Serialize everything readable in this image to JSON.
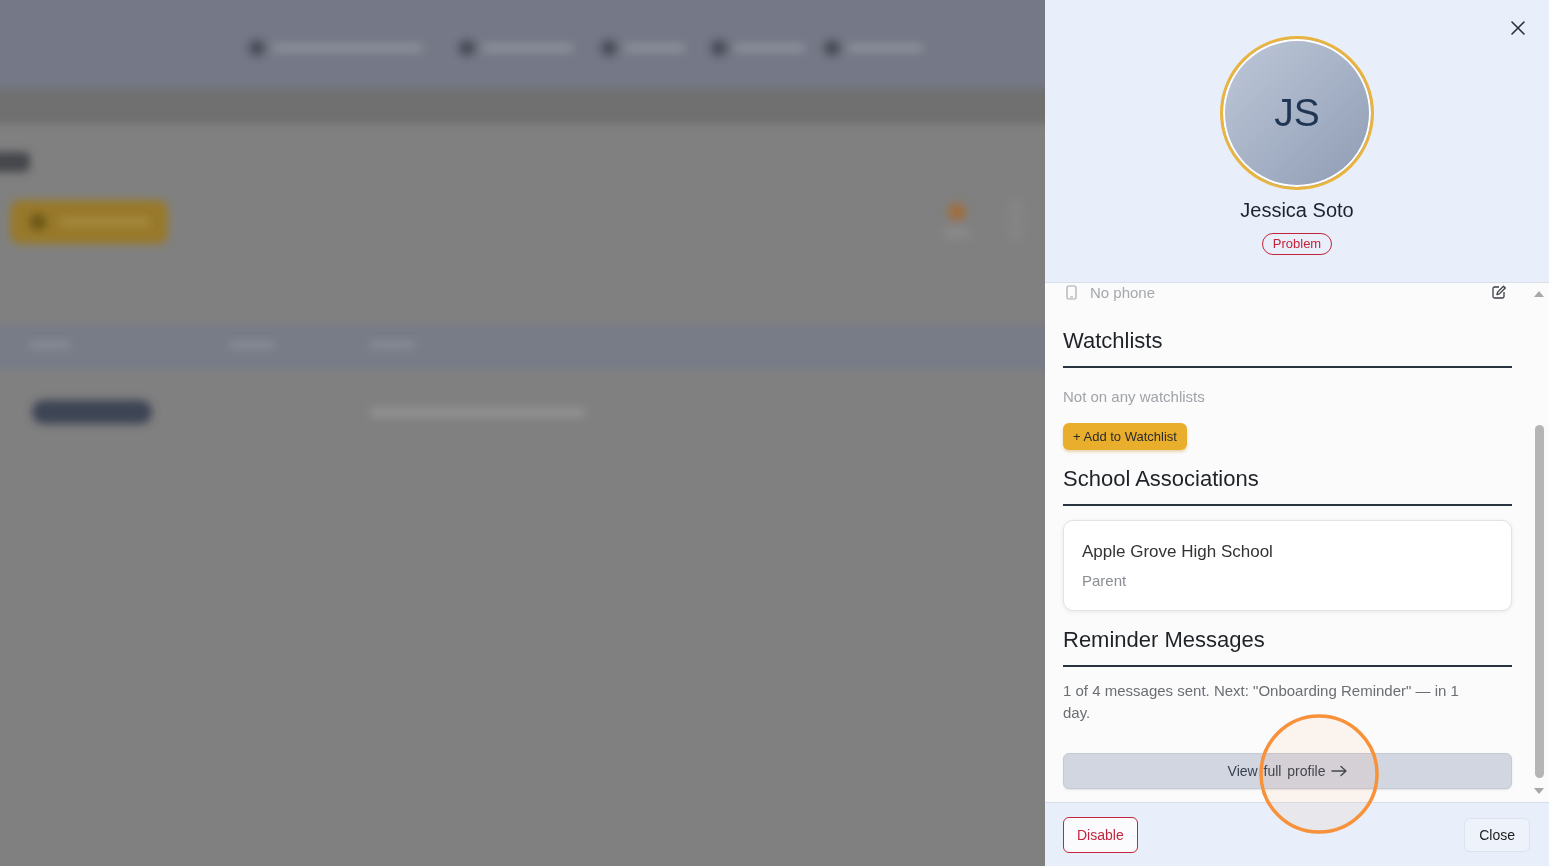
{
  "drawer": {
    "profile": {
      "initials": "JS",
      "name": "Jessica Soto",
      "status_badge": "Problem"
    },
    "contact": {
      "phone": "No phone"
    },
    "sections": [
      {
        "kind": "watchlists",
        "title": "Watchlists",
        "empty_text": "Not on any watchlists",
        "button": "+ Add to Watchlist"
      },
      {
        "kind": "associations",
        "title": "School Associations",
        "items": [
          {
            "school": "Apple Grove High School",
            "role": "Parent"
          }
        ]
      },
      {
        "kind": "reminders",
        "title": "Reminder Messages",
        "text": "1 of 4 messages sent. Next: \"Onboarding Reminder\" — in 1 day."
      }
    ],
    "view_profile_button": "View full profile",
    "footer": {
      "buttons": [
        {
          "kind": "danger",
          "label": "Disable"
        },
        {
          "kind": "secondary",
          "label": "Close"
        }
      ]
    }
  }
}
